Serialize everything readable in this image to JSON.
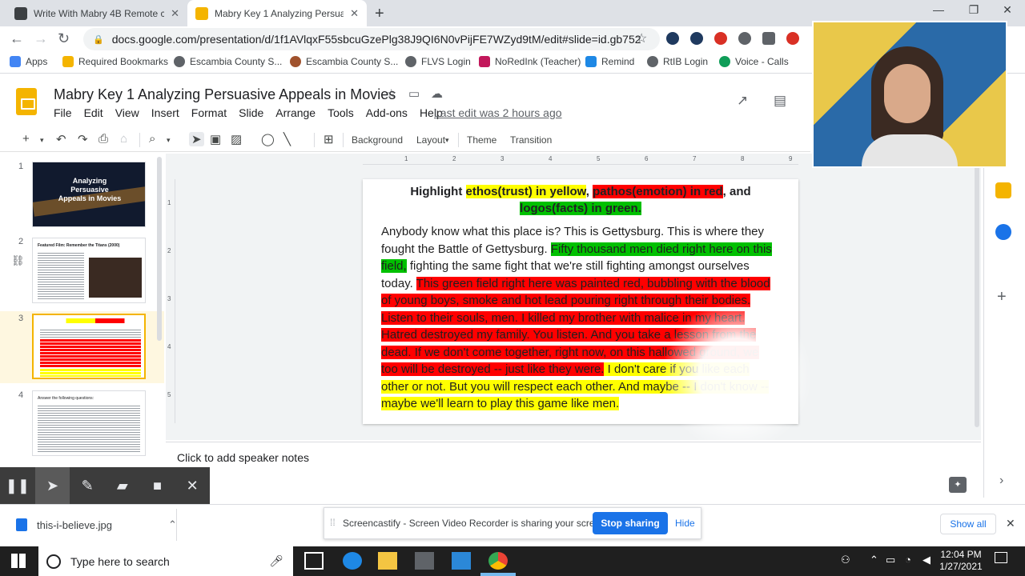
{
  "browser": {
    "tabs": [
      {
        "title": "Write With Mabry 4B Remote cm",
        "active": false
      },
      {
        "title": "Mabry Key 1 Analyzing Persuasive",
        "active": true
      }
    ],
    "new_tab": "+",
    "url": "docs.google.com/presentation/d/1f1AVlqxF55sbcuGzePlg38J9QI6N0vPijFE7WZyd9tM/edit#slide=id.gb752b50...",
    "bookmarks": [
      "Apps",
      "Required Bookmarks",
      "Escambia County S...",
      "Escambia County S...",
      "FLVS Login",
      "NoRedInk (Teacher)",
      "Remind",
      "RtIB Login",
      "Voice - Calls"
    ]
  },
  "app": {
    "title": "Mabry Key 1 Analyzing Persuasive Appeals in Movies",
    "menu": [
      "File",
      "Edit",
      "View",
      "Insert",
      "Format",
      "Slide",
      "Arrange",
      "Tools",
      "Add-ons",
      "Help"
    ],
    "last_edit": "Last edit was 2 hours ago",
    "toolbar": {
      "background": "Background",
      "layout": "Layout",
      "theme": "Theme",
      "transition": "Transition"
    }
  },
  "filmstrip": {
    "slides": [
      {
        "num": "1",
        "text": "Analyzing Persuasive Appeals in Movies"
      },
      {
        "num": "2",
        "text": "Featured Film: Remember the Titans (2000)"
      },
      {
        "num": "3",
        "text": ""
      },
      {
        "num": "4",
        "text": "Answer the following questions:"
      }
    ],
    "selected": 3
  },
  "ruler": {
    "top": [
      "1",
      "2",
      "3",
      "4",
      "5",
      "6",
      "7",
      "8",
      "9"
    ],
    "left": [
      "1",
      "2",
      "3",
      "4",
      "5"
    ]
  },
  "slide": {
    "heading": {
      "p1": "Highlight ",
      "ethos": "ethos(trust) in yellow",
      "p2": ", ",
      "pathos": "pathos(emotion) in red",
      "p3": ", and",
      "logos": "logos(facts) in green."
    },
    "body": {
      "s1": "Anybody know what this place is? This is Gettysburg. This is where they fought the Battle of Gettysburg. ",
      "s2_green": "Fifty thousand men died right here on this field,",
      "s3": " fighting the same fight that we're still fighting amongst ourselves today. ",
      "s4_red": "This green field right here was painted red, bubbling with the blood of young boys, smoke and hot lead pouring right through their bodies. Listen to their souls, men. I killed my brother with malice in my heart. Hatred destroyed my family. You listen. And you take a lesson from the dead. If we don't come together, right now, on this hallowed ground, we too will be destroyed -- just like they were.",
      "s5_yellow": " I don't care if you like each other or not. But you will respect each other. And maybe -- I don't know -- maybe we'll learn to play this game like men."
    }
  },
  "notes": {
    "placeholder": "Click to add speaker notes"
  },
  "downloads": {
    "file": "this-i-believe.jpg",
    "share_message": "Screencastify - Screen Video Recorder is sharing your screen.",
    "stop": "Stop sharing",
    "hide": "Hide",
    "show_all": "Show all"
  },
  "taskbar": {
    "search_placeholder": "Type here to search",
    "time": "12:04 PM",
    "date": "1/27/2021"
  },
  "colors": {
    "accent_yellow": "#f4b400",
    "highlight_yellow": "#ffff00",
    "highlight_red": "#ff0000",
    "highlight_green": "#00c000",
    "share_blue": "#1a73e8"
  }
}
